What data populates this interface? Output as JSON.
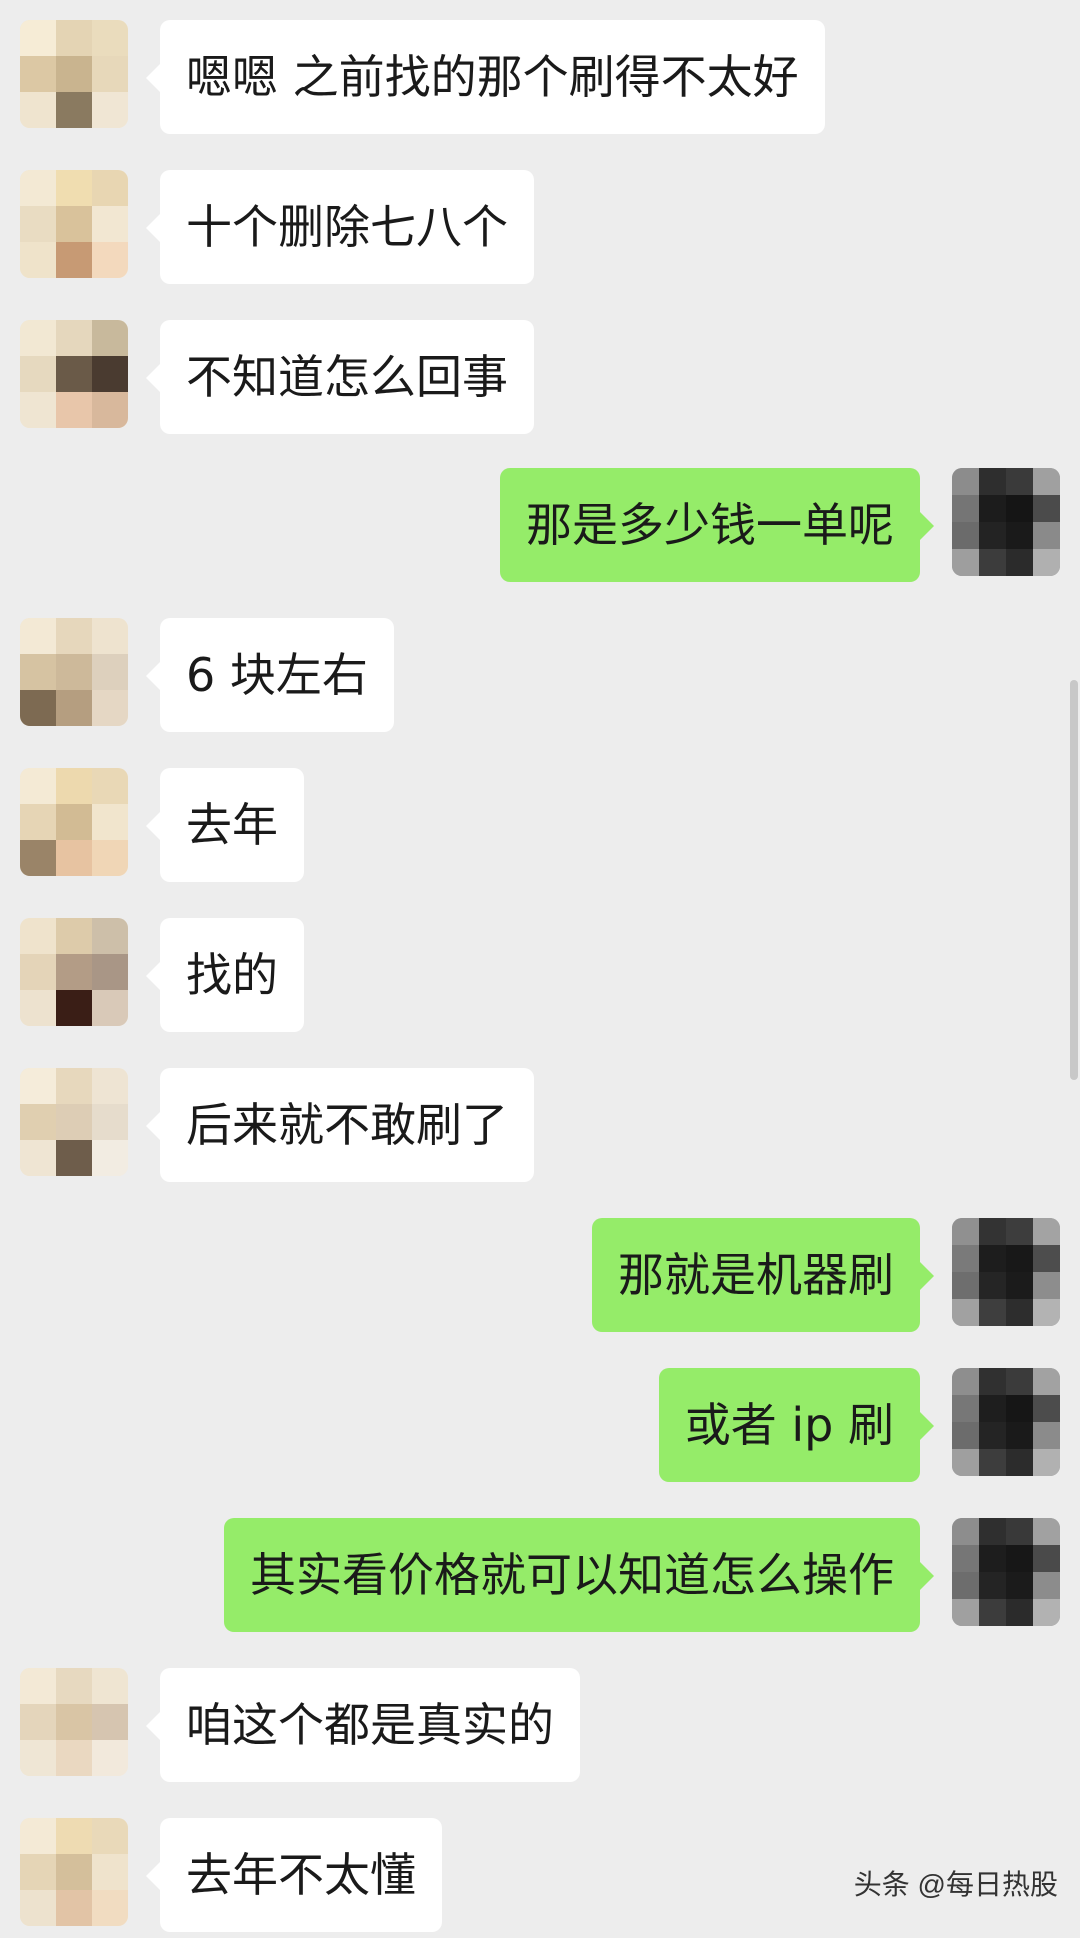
{
  "messages": [
    {
      "side": "left",
      "text": "嗯嗯 之前找的那个刷得不太好"
    },
    {
      "side": "left",
      "text": "十个删除七八个"
    },
    {
      "side": "left",
      "text": "不知道怎么回事"
    },
    {
      "side": "right",
      "text": "那是多少钱一单呢"
    },
    {
      "side": "left",
      "text": "6 块左右"
    },
    {
      "side": "left",
      "text": "去年"
    },
    {
      "side": "left",
      "text": "找的"
    },
    {
      "side": "left",
      "text": "后来就不敢刷了"
    },
    {
      "side": "right",
      "text": "那就是机器刷"
    },
    {
      "side": "right",
      "text": "或者 ip 刷"
    },
    {
      "side": "right",
      "text": "其实看价格就可以知道怎么操作"
    },
    {
      "side": "left",
      "text": "咱这个都是真实的"
    },
    {
      "side": "left",
      "text": "去年不太懂"
    }
  ],
  "watermark": "头条 @每日热股",
  "colors": {
    "background": "#ededed",
    "incoming_bubble": "#ffffff",
    "outgoing_bubble": "#95ec69"
  }
}
